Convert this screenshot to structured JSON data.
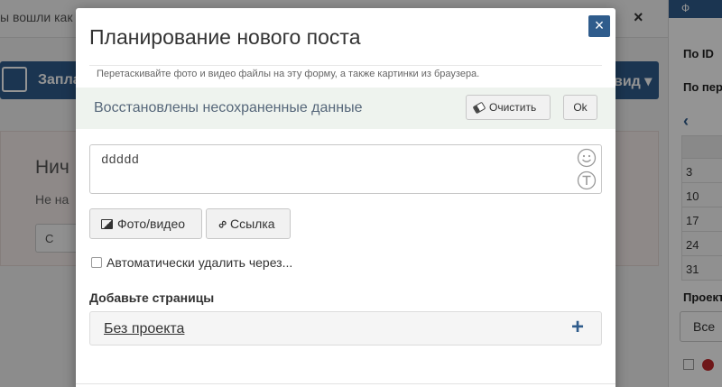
{
  "background": {
    "notice_text": "ы вошли как",
    "notice_close": "×",
    "action_bar_label": "Запла",
    "action_bar_right": "вид ▾",
    "empty_title": "Нич",
    "empty_text": "Не на",
    "empty_button": "С",
    "sidebar": {
      "tab": "Ф",
      "filter_id": "По ID",
      "filter_period": "По пер",
      "prev_icon": "‹",
      "calendar_days": [
        "3",
        "10",
        "17",
        "24",
        "31"
      ],
      "projects_label": "Проект",
      "projects_select": "Все"
    }
  },
  "modal": {
    "title": "Планирование нового поста",
    "close_label": "×",
    "hint": "Перетаскивайте фото и видео файлы на эту форму, а также картинки из браузера.",
    "restore": {
      "text": "Восстановлены несохраненные данные",
      "clear_label": "Очистить",
      "ok_label": "Ok"
    },
    "editor": {
      "value": "ddddd"
    },
    "buttons": {
      "photo_label": "Фото/видео",
      "link_label": "Ссылка"
    },
    "auto_delete_label": "Автоматически удалить через...",
    "pages": {
      "title": "Добавьте страницы",
      "project_name": "Без проекта"
    }
  },
  "colors": {
    "accent": "#2f5c8c",
    "restore_bg": "#eef3ee"
  }
}
